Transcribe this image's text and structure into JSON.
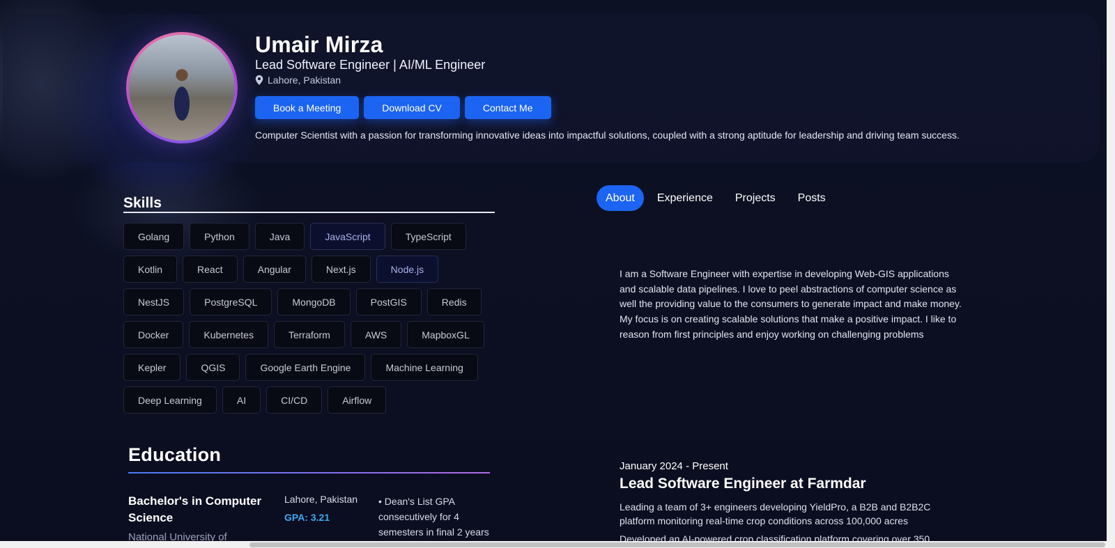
{
  "profile": {
    "name": "Umair Mirza",
    "title": "Lead Software Engineer | AI/ML Engineer",
    "location": "Lahore, Pakistan",
    "tagline": "Computer Scientist with a passion for transforming innovative ideas into impactful solutions, coupled with a strong aptitude for leadership and driving team success."
  },
  "actions": {
    "book": "Book a Meeting",
    "cv": "Download CV",
    "contact": "Contact Me"
  },
  "skills": {
    "title": "Skills",
    "items": [
      "Golang",
      "Python",
      "Java",
      "JavaScript",
      "TypeScript",
      "Kotlin",
      "React",
      "Angular",
      "Next.js",
      "Node.js",
      "NestJS",
      "PostgreSQL",
      "MongoDB",
      "PostGIS",
      "Redis",
      "Docker",
      "Kubernetes",
      "Terraform",
      "AWS",
      "MapboxGL",
      "Kepler",
      "QGIS",
      "Google Earth Engine",
      "Machine Learning",
      "Deep Learning",
      "AI",
      "CI/CD",
      "Airflow"
    ],
    "highlighted": [
      "JavaScript",
      "Node.js"
    ]
  },
  "education": {
    "title": "Education",
    "degree": "Bachelor's in Computer Science",
    "school": "National University of",
    "location": "Lahore, Pakistan",
    "gpa": "GPA: 3.21",
    "note": "• Dean's List GPA consecutively for 4 semesters in final 2 years"
  },
  "tabs": {
    "about": "About",
    "experience": "Experience",
    "projects": "Projects",
    "posts": "Posts"
  },
  "about": {
    "text": "I am a Software Engineer with expertise in developing Web-GIS applications and scalable data pipelines. I love to peel abstractions of computer science as well the providing value to the consumers to generate impact and make money. My focus is on creating scalable solutions that make a positive impact. I like to reason from first principles and enjoy working on challenging problems"
  },
  "experience": {
    "date": "January 2024 - Present",
    "title": "Lead Software Engineer at Farmdar",
    "line1": "Leading a team of 3+ engineers developing YieldPro, a B2B and B2B2C platform monitoring real-time crop conditions across 100,000 acres",
    "line2": "Developed an AI-powered crop classification platform covering over 350"
  },
  "colors": {
    "accent": "#1c64f2",
    "background": "#0c0f22",
    "gpa": "#3ba8f0"
  }
}
